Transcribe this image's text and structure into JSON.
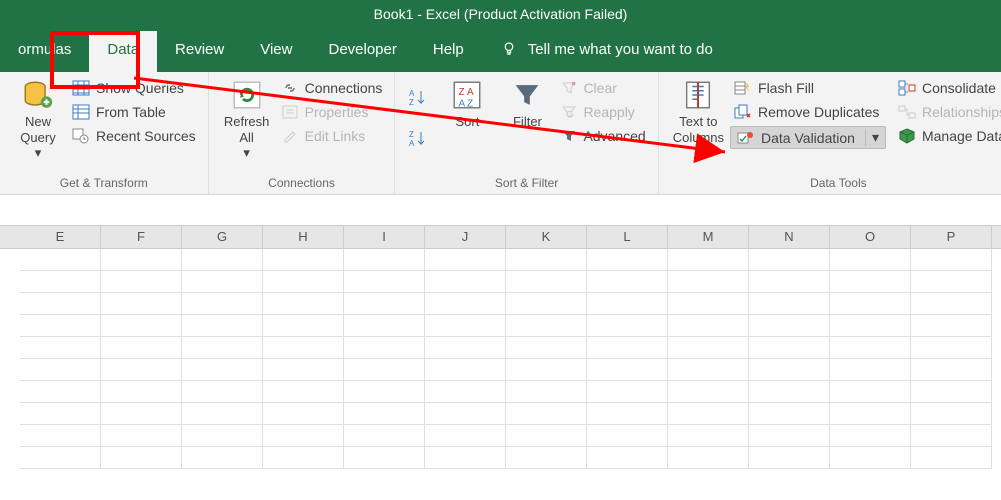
{
  "title": "Book1  -  Excel (Product Activation Failed)",
  "tabs": {
    "formulas": "ormulas",
    "data": "Data",
    "review": "Review",
    "view": "View",
    "developer": "Developer",
    "help": "Help",
    "tellme": "Tell me what you want to do"
  },
  "ribbon": {
    "get_transform": {
      "new_query": "New\nQuery",
      "show_queries": "Show Queries",
      "from_table": "From Table",
      "recent_sources": "Recent Sources",
      "label": "Get & Transform"
    },
    "connections": {
      "refresh_all": "Refresh\nAll",
      "connections": "Connections",
      "properties": "Properties",
      "edit_links": "Edit Links",
      "label": "Connections"
    },
    "sort_filter": {
      "sort": "Sort",
      "filter": "Filter",
      "clear": "Clear",
      "reapply": "Reapply",
      "advanced": "Advanced",
      "label": "Sort & Filter"
    },
    "data_tools": {
      "text_to_columns": "Text to\nColumns",
      "flash_fill": "Flash Fill",
      "remove_duplicates": "Remove Duplicates",
      "data_validation": "Data Validation",
      "consolidate": "Consolidate",
      "relationships": "Relationships",
      "manage_data": "Manage Data",
      "label": "Data Tools"
    }
  },
  "columns": [
    "E",
    "F",
    "G",
    "H",
    "I",
    "J",
    "K",
    "L",
    "M",
    "N",
    "O",
    "P"
  ],
  "annotation": {
    "from": "tab-data",
    "to": "data-validation-button"
  }
}
